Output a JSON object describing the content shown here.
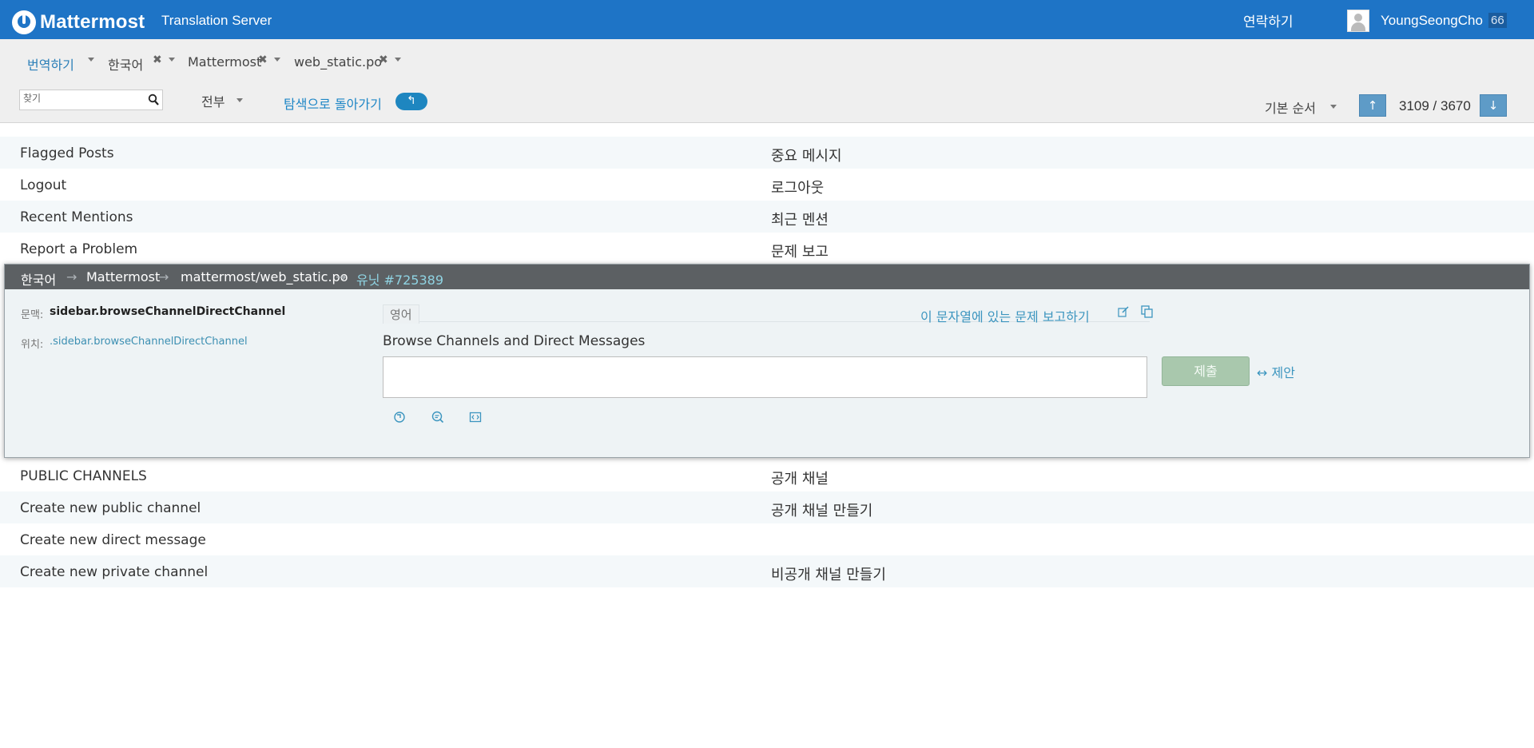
{
  "header": {
    "logo_text": "Mattermost",
    "subtitle": "Translation Server",
    "contact_label": "연락하기",
    "username": "YoungSeongCho",
    "user_count": "66"
  },
  "breadcrumbs": [
    "번역하기",
    "한국어",
    "Mattermost",
    "web_static.po"
  ],
  "toolbar": {
    "search_placeholder": "찾기",
    "filter_label": "전부",
    "back_label": "탐색으로 돌아가기",
    "back_icon": "↰",
    "sort_label": "기본 순서",
    "prev_icon": "↑",
    "next_icon": "↓",
    "position": "3109 / 3670"
  },
  "rows_above": [
    {
      "source": "Flagged Posts",
      "target": "중요 메시지"
    },
    {
      "source": "Logout",
      "target": "로그아웃"
    },
    {
      "source": "Recent Mentions",
      "target": "최근 멘션"
    },
    {
      "source": "Report a Problem",
      "target": "문제 보고"
    }
  ],
  "editor": {
    "path": [
      "한국어",
      "Mattermost",
      "mattermost/web_static.po",
      "유닛 #725389"
    ],
    "arrow": "→",
    "context_label": "문맥:",
    "context_value": "sidebar.browseChannelDirectChannel",
    "location_label": "위치:",
    "location_value": ".sidebar.browseChannelDirectChannel",
    "language_tab": "영어",
    "report_link": "이 문자열에 있는 문제 보고하기",
    "source_text": "Browse Channels and Direct Messages",
    "translation_value": "",
    "submit_label": "제출",
    "suggest_label": "↔ 제안"
  },
  "rows_below": [
    {
      "source": "PUBLIC CHANNELS",
      "target": "공개 채널"
    },
    {
      "source": "Create new public channel",
      "target": "공개 채널 만들기"
    },
    {
      "source": "Create new direct message",
      "target": ""
    },
    {
      "source": "Create new private channel",
      "target": "비공개 채널 만들기"
    }
  ],
  "colors": {
    "header_bg": "#1e74c6",
    "link": "#1d86c6",
    "submit_bg": "#a9c8ad",
    "editor_head_bg": "#5c6063"
  }
}
